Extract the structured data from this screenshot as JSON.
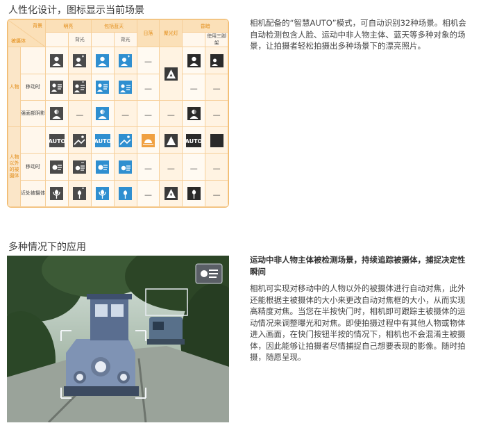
{
  "section1": {
    "title": "人性化设计，图标显示当前场景"
  },
  "section2": {
    "title": "多种情况下的应用"
  },
  "table": {
    "corner_bg": "背景",
    "corner_subject": "被摄体",
    "headers": [
      "明亮",
      "包括蓝天",
      "日落",
      "聚光灯",
      "昏暗"
    ],
    "subheaders": [
      "背光",
      "背光",
      "使用三脚架"
    ],
    "group_person": "人物",
    "group_other": "人物以外的被摄体",
    "row_labels": {
      "person_moving": "移动时",
      "person_shadow": "强面部阴影",
      "other_moving": "移动时",
      "other_close": "近处被摄体"
    },
    "dash": "—",
    "auto": "AUTO"
  },
  "para1": "相机配备的“智慧AUTO”模式，可自动识别32种场景。相机会自动检测包含人脸、运动中非人物主体、蓝天等多种对象的场景，让拍摄者轻松拍摄出多种场景下的漂亮照片。",
  "heading2": "运动中非人物主体被检测场景，持续追踪被摄体，捕捉决定性瞬间",
  "para2": "相机可实现对移动中的人物以外的被摄体进行自动对焦，此外还能根据主被摄体的大小来更改自动对焦框的大小，从而实现高精度对焦。当您在半按快门时，相机即可跟踪主被摄体的运动情况来调整曝光和对焦。即使拍摄过程中有其他人物或物体进入画面，在快门按钮半按的情况下，相机也不会混淆主被摄体，因此能够让拍摄者尽情捕捉自己想要表现的影像。随时拍摄，随愿呈现。",
  "colors": {
    "table_border": "#f0b869",
    "table_header": "#fbe0b8",
    "header_text": "#e28a12",
    "icon_dark": "#4a4a4a",
    "icon_blue": "#2f8fd0",
    "icon_sunset": "#f0a040"
  },
  "icons": {
    "portrait": "portrait-icon",
    "portrait_backlit": "portrait-backlit-icon",
    "moving": "moving-subject-icon",
    "auto": "auto-icon",
    "sunset": "sunset-icon",
    "spotlight": "spotlight-icon",
    "night_tripod": "night-tripod-icon",
    "macro": "macro-flower-icon",
    "focus_tracking": "focus-tracking-icon"
  }
}
